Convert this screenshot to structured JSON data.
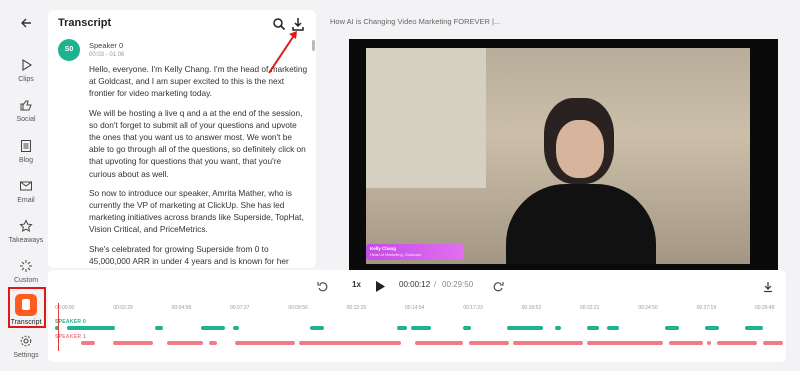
{
  "rail": {
    "items": [
      {
        "label": "Clips",
        "icon": "play-icon"
      },
      {
        "label": "Social",
        "icon": "thumbs-up-icon"
      },
      {
        "label": "Blog",
        "icon": "document-icon"
      },
      {
        "label": "Email",
        "icon": "mail-icon"
      },
      {
        "label": "Takeaways",
        "icon": "star-icon"
      },
      {
        "label": "Custom",
        "icon": "sparkle-icon"
      },
      {
        "label": "Transcript",
        "icon": "transcript-icon"
      },
      {
        "label": "Settings",
        "icon": "gear-icon"
      }
    ],
    "active": "Transcript"
  },
  "transcript": {
    "title": "Transcript",
    "speaker": {
      "avatar": "S0",
      "name": "Speaker 0",
      "time": "00:03 - 01:06"
    },
    "paragraphs": [
      "Hello, everyone. I'm Kelly Chang. I'm the head of marketing at Goldcast, and I am super excited to this is the next frontier for video marketing today.",
      "We will be hosting a live q and a at the end of the session, so don't forget to submit all of your questions and upvote the ones that you want us to answer most. We won't be able to go through all of the questions, so definitely click on that upvoting for questions that you want, that you're curious about as well.",
      "So now to introduce our speaker, Amrita Mather, who is currently the VP of marketing at ClickUp. She has led marketing initiatives across brands like Superside, TopHat, Vision Critical, and PriceMetrics.",
      "She's celebrated for growing Superside from 0 to 45,000,000 ARR in under 4 years and is known for her"
    ]
  },
  "video": {
    "title": "How AI is Changing Video Marketing FOREVER |...",
    "lower_third_name": "Kelly Chang",
    "lower_third_role": "Head of Marketing, Goldcast"
  },
  "player": {
    "speed": "1x",
    "current_time": "00:00:12",
    "separator": "/",
    "total_time": "00:29:50",
    "ticks": [
      "00:00:00",
      "00:02:29",
      "00:04:58",
      "00:07:27",
      "00:09:56",
      "00:12:25",
      "00:14:54",
      "00:17:23",
      "00:19:52",
      "00:22:21",
      "00:24:50",
      "00:27:19",
      "00:29:48"
    ],
    "tracks": [
      {
        "label": "SPEAKER 0",
        "color": "#1fb28e"
      },
      {
        "label": "SPEAKER 1",
        "color": "#f07a85"
      }
    ]
  },
  "colors": {
    "accent": "#ff5a1f",
    "speaker0": "#1fb28e",
    "speaker1": "#f07a85",
    "highlight": "#e01818"
  }
}
